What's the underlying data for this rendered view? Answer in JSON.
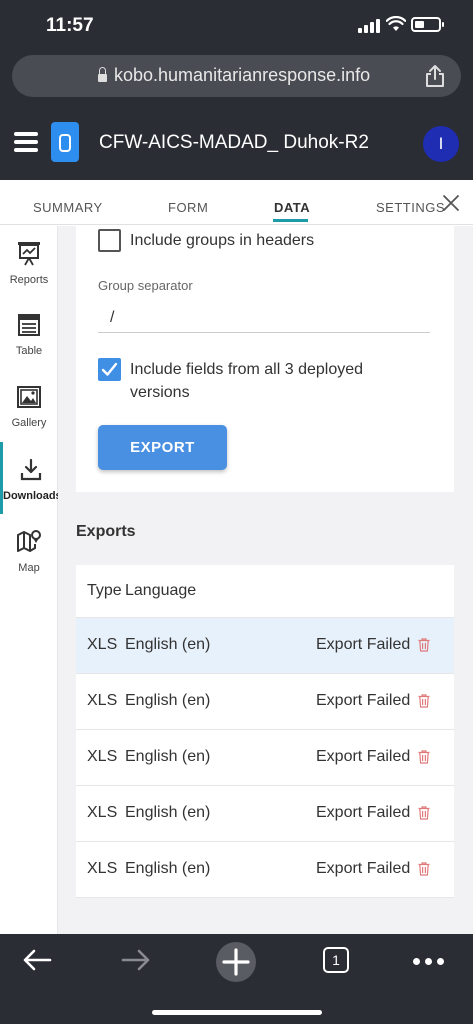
{
  "status_bar": {
    "time": "11:57"
  },
  "browser": {
    "url": "kobo.humanitarianresponse.info"
  },
  "app": {
    "title": "CFW-AICS-MADAD_ Duhok-R2",
    "avatar_initial": "I"
  },
  "tabs": [
    {
      "label": "SUMMARY",
      "active": false
    },
    {
      "label": "FORM",
      "active": false
    },
    {
      "label": "DATA",
      "active": true
    },
    {
      "label": "SETTINGS",
      "active": false
    }
  ],
  "sidebar": {
    "items": [
      {
        "label": "Reports",
        "icon": "reports-icon"
      },
      {
        "label": "Table",
        "icon": "table-icon"
      },
      {
        "label": "Gallery",
        "icon": "gallery-icon"
      },
      {
        "label": "Downloads",
        "icon": "download-icon",
        "active": true
      },
      {
        "label": "Map",
        "icon": "map-icon"
      }
    ]
  },
  "export_form": {
    "include_groups_label": "Include groups in headers",
    "include_groups_checked": false,
    "group_separator_label": "Group separator",
    "group_separator_value": "/",
    "include_fields_label_line1": "Include fields from all 3 deployed",
    "include_fields_label_line2": "versions",
    "include_fields_checked": true,
    "export_button": "EXPORT"
  },
  "exports": {
    "title": "Exports",
    "header": {
      "type": "Type",
      "language": "Language"
    },
    "rows": [
      {
        "type": "XLS",
        "language": "English (en)",
        "status": "Export Failed"
      },
      {
        "type": "XLS",
        "language": "English (en)",
        "status": "Export Failed"
      },
      {
        "type": "XLS",
        "language": "English (en)",
        "status": "Export Failed"
      },
      {
        "type": "XLS",
        "language": "English (en)",
        "status": "Export Failed"
      },
      {
        "type": "XLS",
        "language": "English (en)",
        "status": "Export Failed"
      }
    ]
  },
  "bottom_nav": {
    "tab_count": "1"
  },
  "colors": {
    "accent_teal": "#1e9ba8",
    "primary_blue": "#4a90e2",
    "header_dark": "#2b2d34",
    "delete_red": "#e07a7a"
  }
}
